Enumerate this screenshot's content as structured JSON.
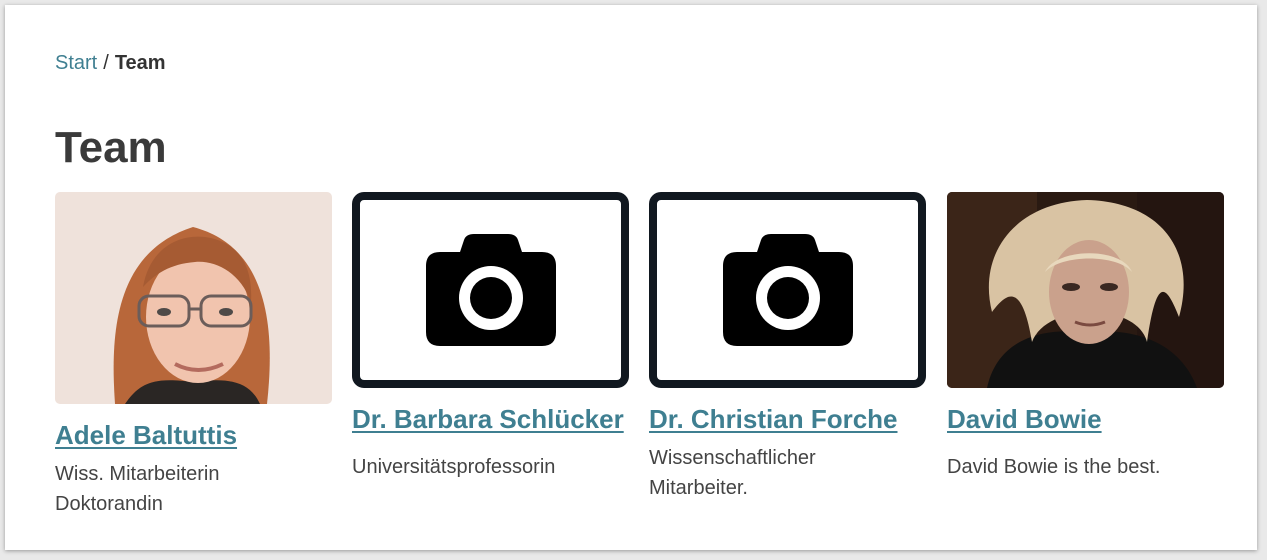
{
  "breadcrumb": {
    "home": "Start",
    "separator": "/",
    "current": "Team"
  },
  "page_title": "Team",
  "team": [
    {
      "name": "Adele Baltuttis",
      "desc1": "Wiss. Mitarbeiterin",
      "desc2": "Doktorandin",
      "photo": "portrait-photo"
    },
    {
      "name": "Dr. Barbara Schlücker",
      "desc1": "Universitätsprofessorin",
      "photo": "camera-icon"
    },
    {
      "name": "Dr. Christian Forche",
      "desc1": "Wissenschaftlicher",
      "desc2": "Mitarbeiter.",
      "photo": "camera-icon"
    },
    {
      "name": "David Bowie",
      "desc1": "David Bowie is the best.",
      "photo": "portrait-photo"
    }
  ],
  "colors": {
    "link": "#3f7f91",
    "heading": "#3a3a3a",
    "placeholder_border": "#111820"
  }
}
